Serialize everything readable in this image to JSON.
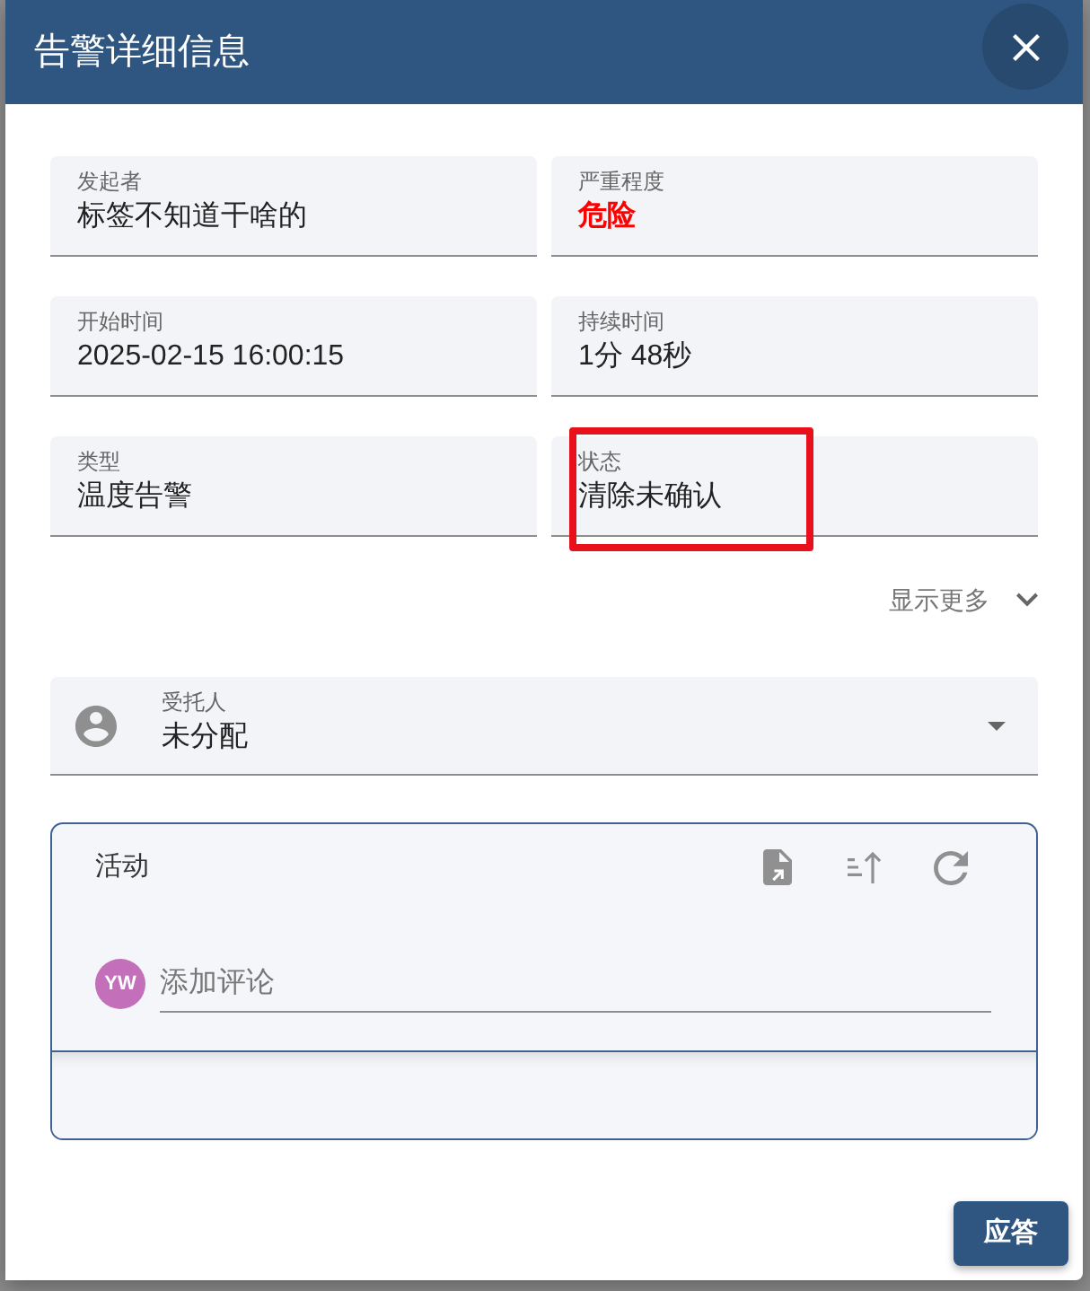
{
  "dialog": {
    "title": "告警详细信息"
  },
  "fields": [
    {
      "label": "发起者",
      "value": "标签不知道干啥的",
      "kind": "plain",
      "marked": false
    },
    {
      "label": "严重程度",
      "value": "危险",
      "kind": "danger",
      "marked": false
    },
    {
      "label": "开始时间",
      "value": "2025-02-15 16:00:15",
      "kind": "plain",
      "marked": false
    },
    {
      "label": "持续时间",
      "value": "1分 48秒",
      "kind": "plain",
      "marked": false
    },
    {
      "label": "类型",
      "value": "温度告警",
      "kind": "plain",
      "marked": false
    },
    {
      "label": "状态",
      "value": "清除未确认",
      "kind": "plain",
      "marked": true
    }
  ],
  "show_more": {
    "label": "显示更多",
    "expanded": false
  },
  "assignee": {
    "label": "受托人",
    "value": "未分配"
  },
  "activity": {
    "title": "活动",
    "comment": {
      "avatar": "YW",
      "placeholder": "添加评论"
    }
  },
  "buttons": [
    {
      "label": "应答"
    }
  ]
}
